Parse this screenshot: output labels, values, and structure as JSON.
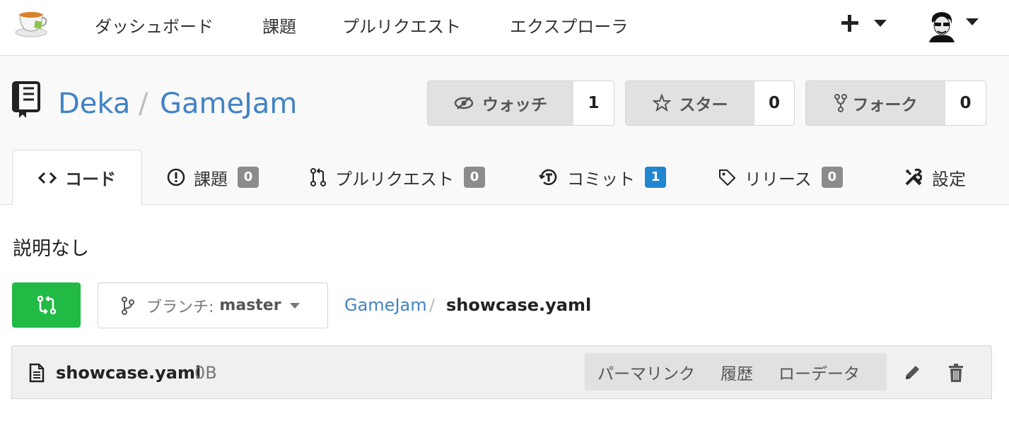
{
  "nav": {
    "items": [
      "ダッシュボード",
      "課題",
      "プルリクエスト",
      "エクスプローラ"
    ],
    "logo_icon": "teacup-logo-icon",
    "create_icon": "plus-icon",
    "avatar_icon": "user-avatar"
  },
  "repo": {
    "owner": "Deka",
    "separator": "/",
    "name": "GameJam",
    "watch": {
      "label": "ウォッチ",
      "count": "1"
    },
    "star": {
      "label": "スター",
      "count": "0"
    },
    "fork": {
      "label": "フォーク",
      "count": "0"
    }
  },
  "tabs": [
    {
      "label": "コード",
      "icon": "code-icon",
      "active": true
    },
    {
      "label": "課題",
      "icon": "issue-icon",
      "count": "0"
    },
    {
      "label": "プルリクエスト",
      "icon": "pull-request-icon",
      "count": "0"
    },
    {
      "label": "コミット",
      "icon": "history-icon",
      "count": "1"
    },
    {
      "label": "リリース",
      "icon": "tag-icon",
      "count": "0"
    },
    {
      "label": "設定",
      "icon": "tools-icon"
    }
  ],
  "description": "説明なし",
  "branch": {
    "label": "ブランチ:",
    "value": "master"
  },
  "breadcrumb": {
    "root": "GameJam",
    "separator": "/",
    "file": "showcase.yaml"
  },
  "file": {
    "name": "showcase.yaml",
    "size": "0B",
    "actions": [
      "パーマリンク",
      "履歴",
      "ローデータ"
    ]
  },
  "colors": {
    "accent": "#4183c4",
    "green": "#21ba45",
    "badge_blue": "#2185d0",
    "badge_gray": "#8c8c8c"
  }
}
